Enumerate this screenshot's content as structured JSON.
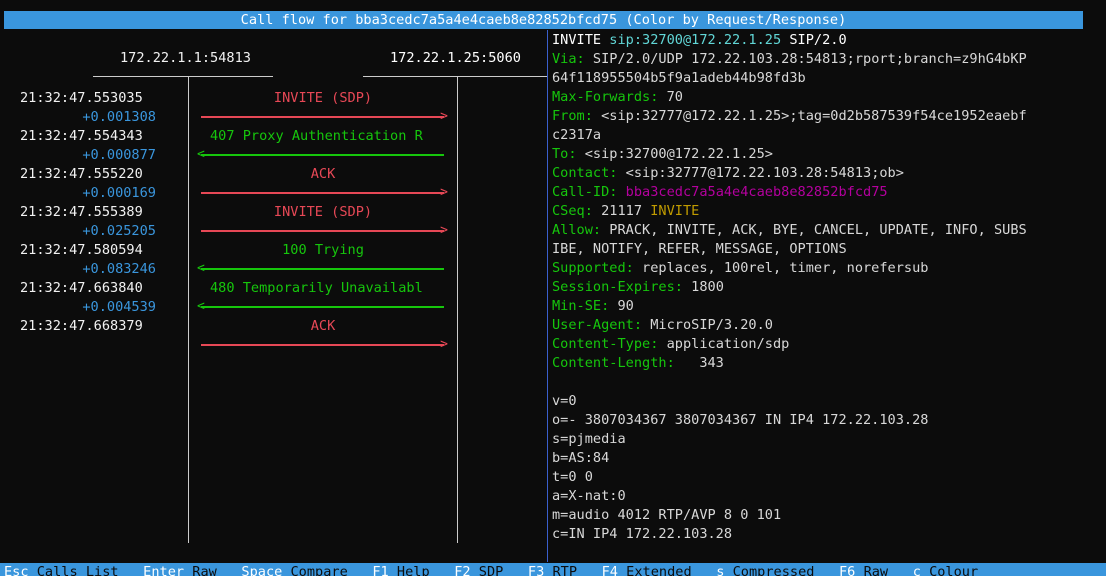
{
  "title": "Call flow for bba3cedc7a5a4e4caeb8e82852bfcd75 (Color by Request/Response)",
  "hosts": {
    "left": "172.22.1.1:54813",
    "right": "172.22.1.25:5060"
  },
  "flow": [
    {
      "time": "21:32:47.553035",
      "delta": "",
      "msg": "INVITE (SDP)",
      "dir": "req"
    },
    {
      "time": "",
      "delta": "+0.001308",
      "msg": "",
      "dir": ""
    },
    {
      "time": "21:32:47.554343",
      "delta": "",
      "msg": "407 Proxy Authentication R",
      "dir": "resp"
    },
    {
      "time": "",
      "delta": "+0.000877",
      "msg": "",
      "dir": ""
    },
    {
      "time": "21:32:47.555220",
      "delta": "",
      "msg": "ACK",
      "dir": "req"
    },
    {
      "time": "",
      "delta": "+0.000169",
      "msg": "",
      "dir": ""
    },
    {
      "time": "21:32:47.555389",
      "delta": "",
      "msg": "INVITE (SDP)",
      "dir": "req"
    },
    {
      "time": "",
      "delta": "+0.025205",
      "msg": "",
      "dir": ""
    },
    {
      "time": "21:32:47.580594",
      "delta": "",
      "msg": "100 Trying",
      "dir": "resp"
    },
    {
      "time": "",
      "delta": "+0.083246",
      "msg": "",
      "dir": ""
    },
    {
      "time": "21:32:47.663840",
      "delta": "",
      "msg": "480 Temporarily Unavailabl",
      "dir": "resp"
    },
    {
      "time": "",
      "delta": "+0.004539",
      "msg": "",
      "dir": ""
    },
    {
      "time": "21:32:47.668379",
      "delta": "",
      "msg": "ACK",
      "dir": "req"
    }
  ],
  "times": [
    "21:32:47.553035",
    "21:32:47.554343",
    "21:32:47.555220",
    "21:32:47.555389",
    "21:32:47.580594",
    "21:32:47.663840",
    "21:32:47.668379"
  ],
  "deltas": [
    "+0.001308",
    "+0.000877",
    "+0.000169",
    "+0.025205",
    "+0.083246",
    "+0.004539"
  ],
  "messages": [
    {
      "label": "INVITE (SDP)",
      "dir": "req"
    },
    {
      "label": "407 Proxy Authentication R",
      "dir": "resp"
    },
    {
      "label": "ACK",
      "dir": "req"
    },
    {
      "label": "INVITE (SDP)",
      "dir": "req"
    },
    {
      "label": "100 Trying",
      "dir": "resp"
    },
    {
      "label": "480 Temporarily Unavailabl",
      "dir": "resp"
    },
    {
      "label": "ACK",
      "dir": "req"
    }
  ],
  "detail": {
    "request_line": {
      "method": "INVITE",
      "uri": "sip:32700@172.22.1.25",
      "version": "SIP/2.0"
    },
    "via_name": "Via:",
    "via_value_1": " SIP/2.0/UDP 172.22.103.28:54813;rport;branch=z9hG4bKP",
    "via_value_2": "64f118955504b5f9a1adeb44b98fd3b",
    "maxfwd_name": "Max-Forwards:",
    "maxfwd_value": " 70",
    "from_name": "From:",
    "from_value_1": " <sip:32777@172.22.1.25>;tag=0d2b587539f54ce1952eaebf",
    "from_value_2": "c2317a",
    "to_name": "To:",
    "to_value": " <sip:32700@172.22.1.25>",
    "contact_name": "Contact:",
    "contact_value": " <sip:32777@172.22.103.28:54813;ob>",
    "callid_name": "Call-ID:",
    "callid_value": " bba3cedc7a5a4e4caeb8e82852bfcd75",
    "cseq_name": "CSeq:",
    "cseq_num": " 21117 ",
    "cseq_method": "INVITE",
    "allow_name": "Allow:",
    "allow_value_1": " PRACK, INVITE, ACK, BYE, CANCEL, UPDATE, INFO, SUBS",
    "allow_value_2": "IBE, NOTIFY, REFER, MESSAGE, OPTIONS",
    "supported_name": "Supported:",
    "supported_value": " replaces, 100rel, timer, norefersub",
    "sessexp_name": "Session-Expires:",
    "sessexp_value": " 1800",
    "minse_name": "Min-SE:",
    "minse_value": " 90",
    "ua_name": "User-Agent:",
    "ua_value": " MicroSIP/3.20.0",
    "ctype_name": "Content-Type:",
    "ctype_value": " application/sdp",
    "clen_name": "Content-Length:",
    "clen_value": "   343",
    "sdp": [
      "v=0",
      "o=- 3807034367 3807034367 IN IP4 172.22.103.28",
      "s=pjmedia",
      "b=AS:84",
      "t=0 0",
      "a=X-nat:0",
      "m=audio 4012 RTP/AVP 8 0 101",
      "c=IN IP4 172.22.103.28"
    ]
  },
  "footer": [
    {
      "key": "Esc",
      "label": "Calls List"
    },
    {
      "key": "Enter",
      "label": "Raw"
    },
    {
      "key": "Space",
      "label": "Compare"
    },
    {
      "key": "F1",
      "label": "Help"
    },
    {
      "key": "F2",
      "label": "SDP"
    },
    {
      "key": "F3",
      "label": "RTP"
    },
    {
      "key": "F4",
      "label": "Extended"
    },
    {
      "key": "s",
      "label": "Compressed"
    },
    {
      "key": "F6",
      "label": "Raw"
    },
    {
      "key": "c",
      "label": "Colour"
    }
  ],
  "colors": {
    "accent": "#3a96dd",
    "request": "#e74856",
    "response": "#16c60c",
    "header": "#16c60c",
    "delta": "#3a96dd",
    "callid": "#b4009e",
    "method": "#c19c00"
  }
}
